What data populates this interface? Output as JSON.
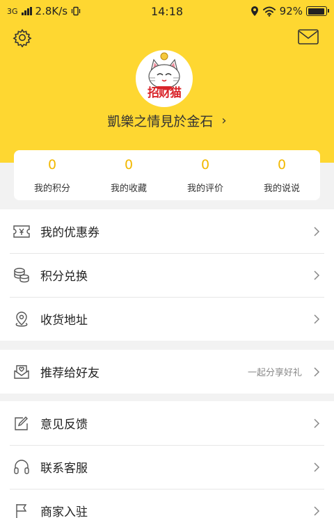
{
  "status_bar": {
    "network": "3G",
    "speed": "2.8K/s",
    "time": "14:18",
    "battery": "92%",
    "battery_level": 0.92,
    "icons": [
      "signal-icon",
      "vibrate-icon",
      "location-icon",
      "wifi-icon",
      "battery-icon"
    ]
  },
  "header": {
    "icons": [
      "gear-icon",
      "mail-icon"
    ],
    "avatar_text": "招财猫",
    "username": "凱樂之情見於金石",
    "username_chevron": "›",
    "colors": {
      "background": "#fed731",
      "accent": "#f2b800",
      "avatar_text": "#d9242a"
    }
  },
  "stats": [
    {
      "value": "0",
      "label": "我的积分"
    },
    {
      "value": "0",
      "label": "我的收藏"
    },
    {
      "value": "0",
      "label": "我的评价"
    },
    {
      "value": "0",
      "label": "我的说说"
    }
  ],
  "menu": {
    "group1": [
      {
        "label": "我的优惠券",
        "icon": "coupon-icon"
      },
      {
        "label": "积分兑换",
        "icon": "coins-icon"
      },
      {
        "label": "收货地址",
        "icon": "location-pin-icon"
      }
    ],
    "group2": [
      {
        "label": "推荐给好友",
        "hint": "一起分享好礼",
        "icon": "gift-envelope-icon"
      }
    ],
    "group3": [
      {
        "label": "意见反馈",
        "icon": "feedback-icon"
      },
      {
        "label": "联系客服",
        "icon": "headset-icon"
      },
      {
        "label": "商家入驻",
        "icon": "flag-icon"
      }
    ]
  }
}
